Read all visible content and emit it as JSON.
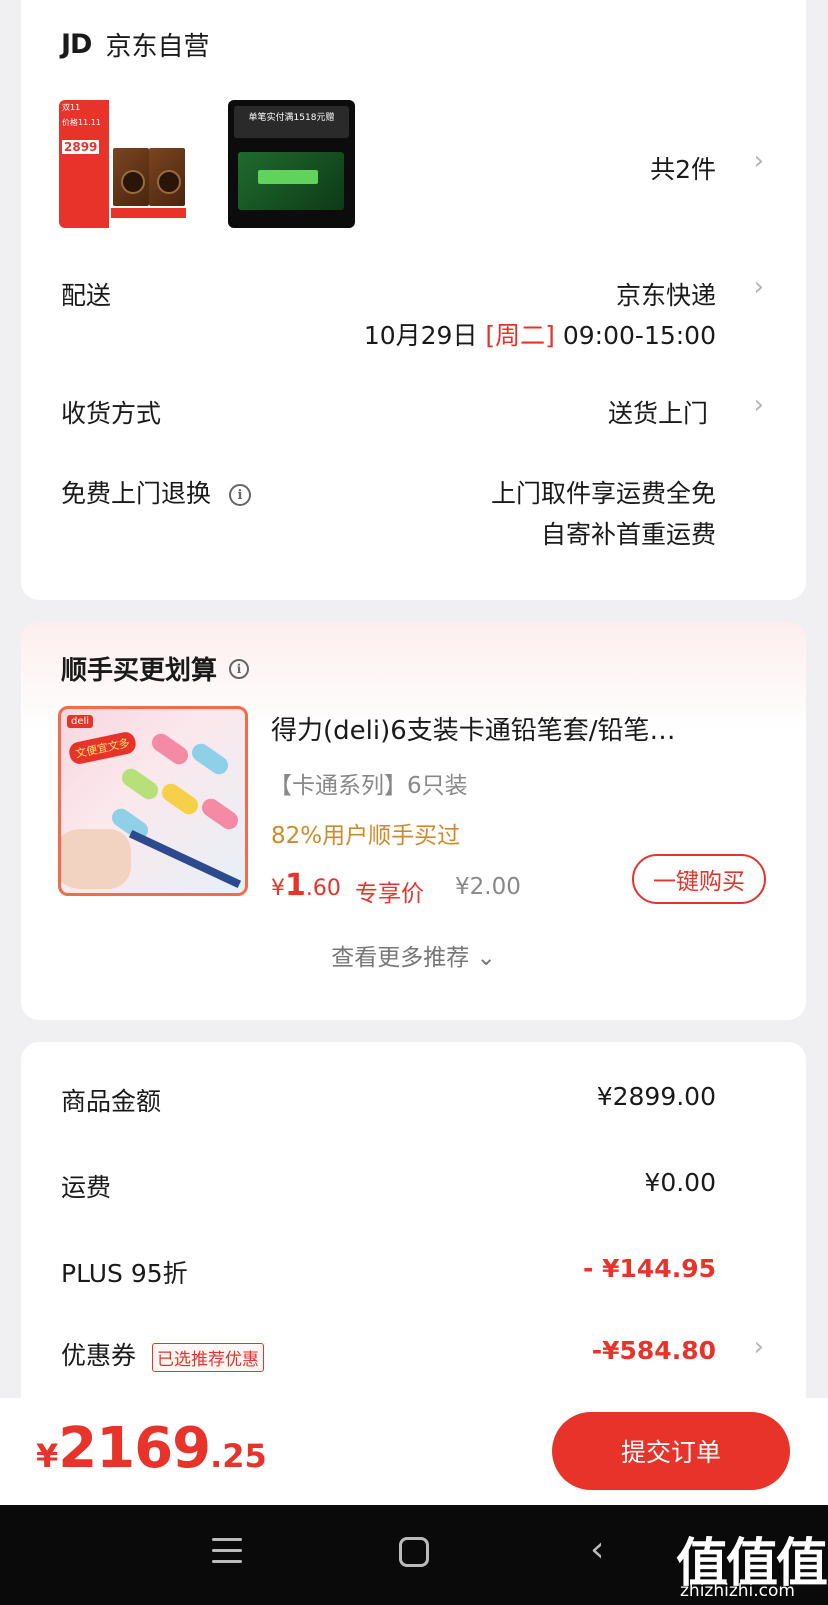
{
  "store": {
    "logo": "JD",
    "name": "京东自营"
  },
  "products": {
    "thumb1": {
      "badge_top": "双11",
      "badge_line": "价格11.11",
      "price": "2899"
    },
    "thumb2": {
      "banner": "单笔实付满1518元赠"
    },
    "count": "共2件"
  },
  "delivery": {
    "label": "配送",
    "carrier": "京东快递",
    "date": "10月29日",
    "weekday": "[周二]",
    "time": "09:00-15:00"
  },
  "receive": {
    "label": "收货方式",
    "value": "送货上门"
  },
  "returns": {
    "label": "免费上门退换",
    "line1": "上门取件享运费全免",
    "line2": "自寄补首重运费"
  },
  "addon": {
    "title": "顺手买更划算",
    "image_brand": "deli",
    "image_badge": "文便宜文多",
    "product_title": "得力(deli)6支装卡通铅笔套/铅笔…",
    "spec": "【卡通系列】6只装",
    "social": "82%用户顺手买过",
    "price_currency": "¥",
    "price_int": "1",
    "price_dec": ".60",
    "price_label": "专享价",
    "orig_price": "¥2.00",
    "buy_label": "一键购买",
    "more_label": "查看更多推荐 ⌄"
  },
  "summary": {
    "goods_label": "商品金额",
    "goods_value": "¥2899.00",
    "shipping_label": "运费",
    "shipping_value": "¥0.00",
    "plus_label": "PLUS 95折",
    "plus_value": "- ¥144.95",
    "coupon_label": "优惠券",
    "coupon_tag": "已选推荐优惠",
    "coupon_value": "-¥584.80"
  },
  "footer": {
    "currency": "¥",
    "total_int": "2169",
    "total_dec": ".25",
    "submit_label": "提交订单"
  },
  "watermark": {
    "text": "值值值",
    "url": "zhizhizhi.com"
  },
  "colors": {
    "accent": "#e8332b",
    "social": "#d08a2a",
    "background": "#f0f0f2"
  },
  "icons": [
    "chevron-right-icon",
    "info-icon",
    "menu-icon",
    "home-icon",
    "back-icon"
  ]
}
